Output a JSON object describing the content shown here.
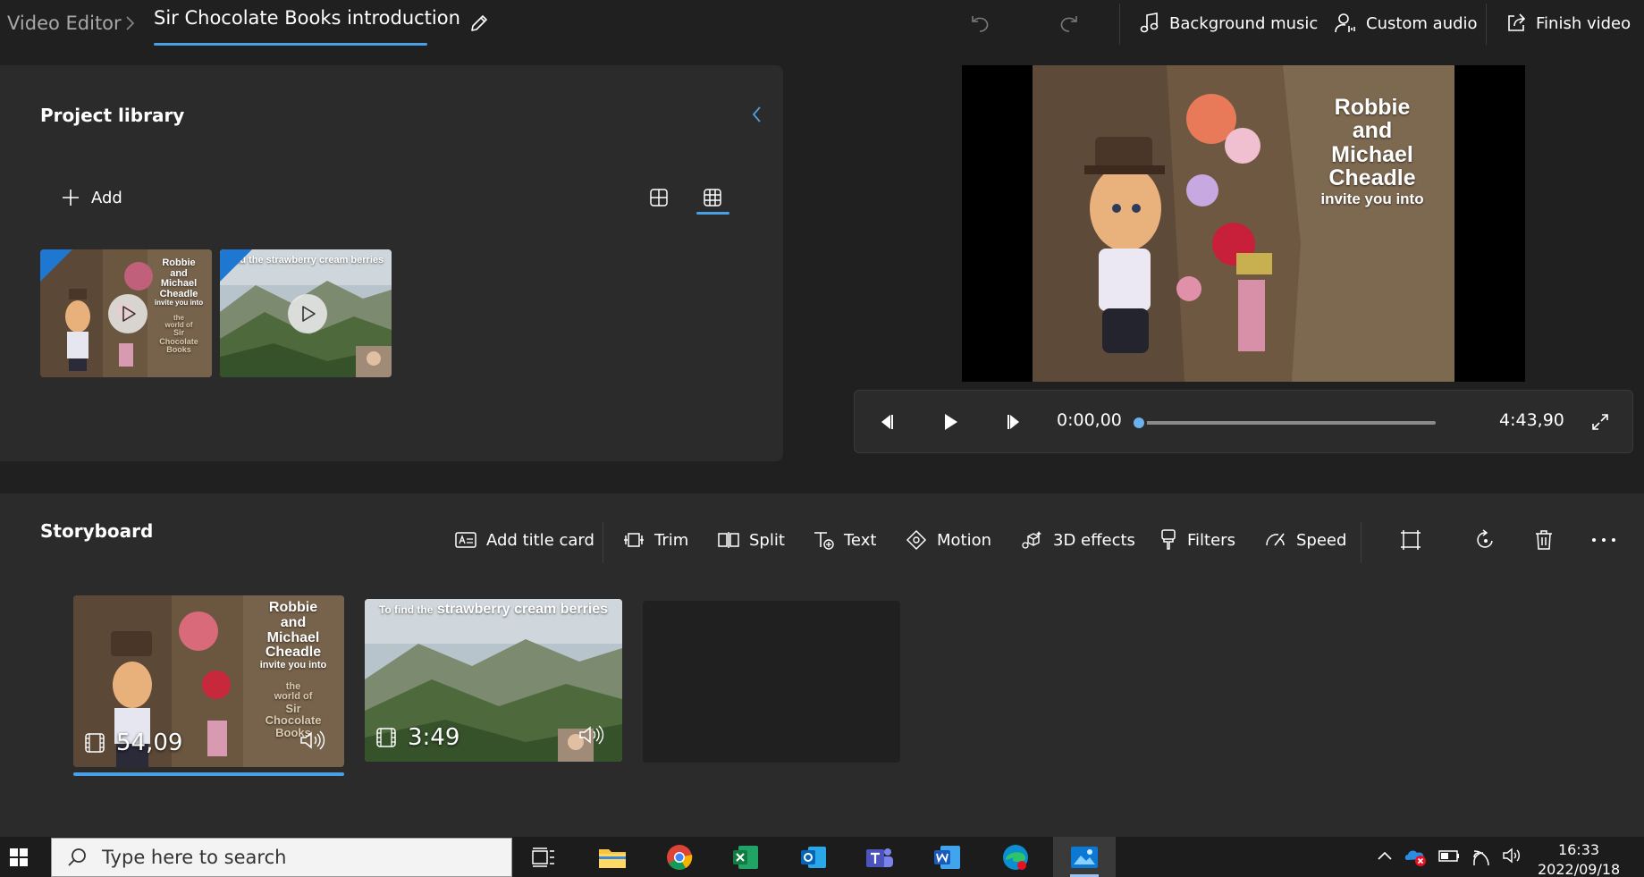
{
  "header": {
    "app_name": "Video Editor",
    "project_title": "Sir Chocolate Books introduction",
    "background_music": "Background music",
    "custom_audio": "Custom audio",
    "finish_video": "Finish video"
  },
  "library": {
    "title": "Project library",
    "add_label": "Add",
    "items": [
      {
        "overlay_lines": [
          "Robbie",
          "and",
          "Michael",
          "Cheadle",
          "invite you into"
        ],
        "overlay_sub": [
          "the",
          "world of",
          "Sir",
          "Chocolate",
          "Books"
        ]
      },
      {
        "overlay_text": "find the strawberry cream berries"
      }
    ]
  },
  "preview": {
    "overlay_lines": [
      "Robbie",
      "and",
      "Michael",
      "Cheadle"
    ],
    "overlay_sub": "invite you into",
    "current_time": "0:00,00",
    "total_time": "4:43,90",
    "progress": 0
  },
  "storyboard": {
    "title": "Storyboard",
    "tools": {
      "add_title_card": "Add title card",
      "trim": "Trim",
      "split": "Split",
      "text": "Text",
      "motion": "Motion",
      "effects_3d": "3D effects",
      "filters": "Filters",
      "speed": "Speed"
    },
    "clips": [
      {
        "duration": "54,09",
        "overlay_lines": [
          "Robbie",
          "and",
          "Michael",
          "Cheadle"
        ],
        "overlay_sub": "invite you into",
        "overlay_sub2": [
          "the",
          "world of",
          "Sir",
          "Chocolate",
          "Books"
        ]
      },
      {
        "duration": "3:49",
        "overlay_text_a": "To find the",
        "overlay_text_b": "strawberry cream berries"
      }
    ]
  },
  "taskbar": {
    "search_placeholder": "Type here to search",
    "time": "16:33",
    "date": "2022/09/18"
  },
  "colors": {
    "accent": "#4aa0e6",
    "background": "#202020",
    "panel": "#2b2b2b"
  }
}
